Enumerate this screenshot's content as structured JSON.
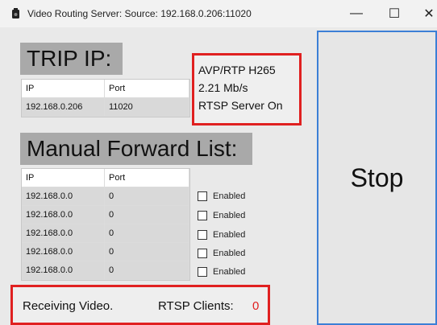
{
  "window": {
    "title": "Video Routing Server: Source: 192.168.0.206:11020",
    "minimize_glyph": "—",
    "maximize_glyph": "☐",
    "close_glyph": "✕"
  },
  "trip": {
    "header": "TRIP IP:",
    "columns": [
      "IP",
      "Port"
    ],
    "rows": [
      [
        "192.168.0.206",
        "11020"
      ]
    ]
  },
  "info": {
    "codec": "AVP/RTP H265",
    "bitrate": "2.21 Mb/s",
    "rtsp_status": "RTSP Server On"
  },
  "manual": {
    "header": "Manual Forward List:",
    "columns": [
      "IP",
      "Port"
    ],
    "rows": [
      [
        "192.168.0.0",
        "0"
      ],
      [
        "192.168.0.0",
        "0"
      ],
      [
        "192.168.0.0",
        "0"
      ],
      [
        "192.168.0.0",
        "0"
      ],
      [
        "192.168.0.0",
        "0"
      ]
    ],
    "enabled_label": "Enabled"
  },
  "status": {
    "left": "Receiving Video.",
    "clients_label": "RTSP Clients:",
    "clients_count": "0"
  },
  "stop_label": "Stop",
  "colors": {
    "highlight": "#e02020",
    "header_bg": "#a9a9a9",
    "button_border": "#3c7fd6"
  },
  "icons": {
    "app": "video-camera-icon"
  }
}
